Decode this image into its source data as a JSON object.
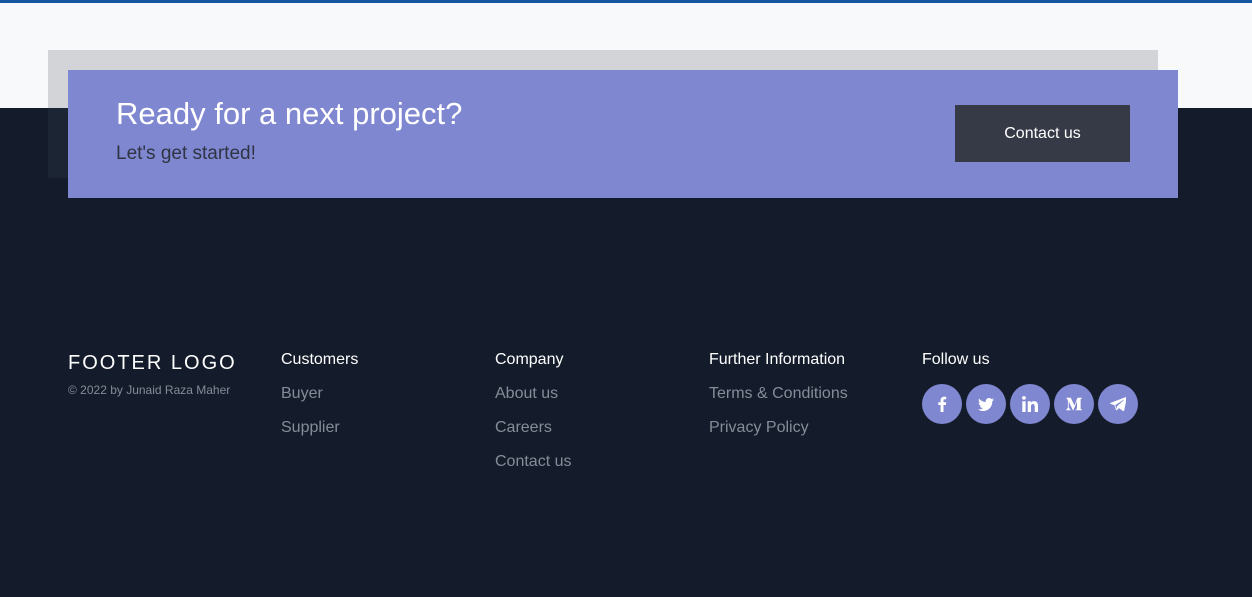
{
  "cta": {
    "title": "Ready for a next project?",
    "subtitle": "Let's get started!",
    "button_label": "Contact us"
  },
  "footer": {
    "logo": "FOOTER LOGO",
    "copyright": "© 2022 by Junaid Raza Maher",
    "columns": [
      {
        "heading": "Customers",
        "links": [
          "Buyer",
          "Supplier"
        ]
      },
      {
        "heading": "Company",
        "links": [
          "About us",
          "Careers",
          "Contact us"
        ]
      },
      {
        "heading": "Further Information",
        "links": [
          "Terms & Conditions",
          "Privacy Policy"
        ]
      }
    ],
    "follow_heading": "Follow us",
    "social": [
      "facebook-icon",
      "twitter-icon",
      "linkedin-icon",
      "medium-icon",
      "telegram-icon"
    ]
  },
  "colors": {
    "accent": "#8087d1",
    "footer_bg": "#141c2b",
    "top_border": "#1456a0",
    "button_bg": "#353a46"
  }
}
